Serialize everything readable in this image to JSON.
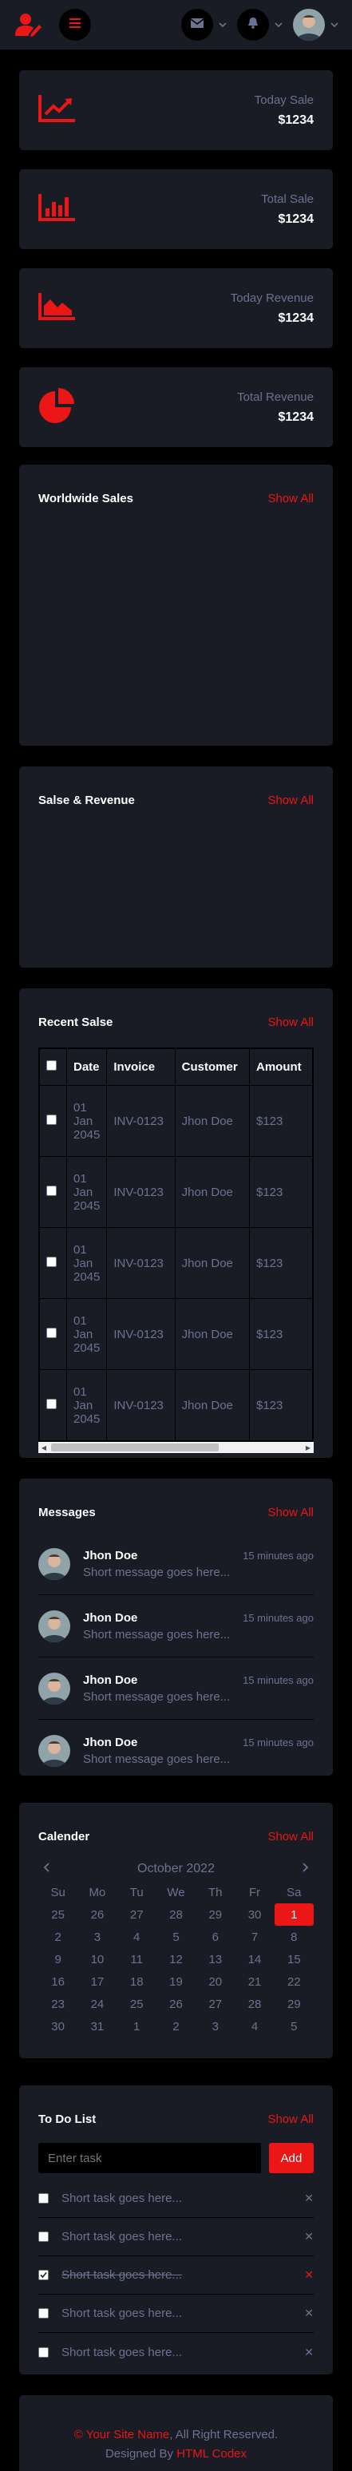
{
  "topbar": {
    "brand_icon": "user-edit-icon",
    "menu_icon": "bars-icon",
    "mail_icon": "envelope-icon",
    "bell_icon": "bell-icon"
  },
  "colors": {
    "primary": "#EB1616",
    "secondary": "#191C24",
    "light": "#6C7293",
    "dark": "#000000"
  },
  "stats": [
    {
      "label": "Today Sale",
      "value": "$1234",
      "icon": "chart-line-icon"
    },
    {
      "label": "Total Sale",
      "value": "$1234",
      "icon": "chart-bar-icon"
    },
    {
      "label": "Today Revenue",
      "value": "$1234",
      "icon": "chart-area-icon"
    },
    {
      "label": "Total Revenue",
      "value": "$1234",
      "icon": "chart-pie-icon"
    }
  ],
  "worldwide": {
    "title": "Worldwide Sales",
    "show_all": "Show All"
  },
  "revenue": {
    "title": "Salse & Revenue",
    "show_all": "Show All"
  },
  "recent": {
    "title": "Recent Salse",
    "show_all": "Show All",
    "headers": [
      "Date",
      "Invoice",
      "Customer",
      "Amount"
    ],
    "rows": [
      {
        "date": "01 Jan 2045",
        "invoice": "INV-0123",
        "customer": "Jhon Doe",
        "amount": "$123"
      },
      {
        "date": "01 Jan 2045",
        "invoice": "INV-0123",
        "customer": "Jhon Doe",
        "amount": "$123"
      },
      {
        "date": "01 Jan 2045",
        "invoice": "INV-0123",
        "customer": "Jhon Doe",
        "amount": "$123"
      },
      {
        "date": "01 Jan 2045",
        "invoice": "INV-0123",
        "customer": "Jhon Doe",
        "amount": "$123"
      },
      {
        "date": "01 Jan 2045",
        "invoice": "INV-0123",
        "customer": "Jhon Doe",
        "amount": "$123"
      }
    ]
  },
  "messages": {
    "title": "Messages",
    "show_all": "Show All",
    "items": [
      {
        "name": "Jhon Doe",
        "time": "15 minutes ago",
        "text": "Short message goes here..."
      },
      {
        "name": "Jhon Doe",
        "time": "15 minutes ago",
        "text": "Short message goes here..."
      },
      {
        "name": "Jhon Doe",
        "time": "15 minutes ago",
        "text": "Short message goes here..."
      },
      {
        "name": "Jhon Doe",
        "time": "15 minutes ago",
        "text": "Short message goes here..."
      }
    ]
  },
  "calendar": {
    "title": "Calender",
    "show_all": "Show All",
    "month": "October 2022",
    "weekdays": [
      "Su",
      "Mo",
      "Tu",
      "We",
      "Th",
      "Fr",
      "Sa"
    ],
    "days": [
      "25",
      "26",
      "27",
      "28",
      "29",
      "30",
      "1",
      "2",
      "3",
      "4",
      "5",
      "6",
      "7",
      "8",
      "9",
      "10",
      "11",
      "12",
      "13",
      "14",
      "15",
      "16",
      "17",
      "18",
      "19",
      "20",
      "21",
      "22",
      "23",
      "24",
      "25",
      "26",
      "27",
      "28",
      "29",
      "30",
      "31",
      "1",
      "2",
      "3",
      "4",
      "5"
    ],
    "selected": "1"
  },
  "todo": {
    "title": "To Do List",
    "show_all": "Show All",
    "placeholder": "Enter task",
    "add_label": "Add",
    "items": [
      {
        "text": "Short task goes here...",
        "done": false
      },
      {
        "text": "Short task goes here...",
        "done": false
      },
      {
        "text": "Short task goes here...",
        "done": true
      },
      {
        "text": "Short task goes here...",
        "done": false
      },
      {
        "text": "Short task goes here...",
        "done": false
      }
    ]
  },
  "footer": {
    "copy": "©",
    "site_name": "Your Site Name",
    "rights": ", All Right Reserved.",
    "designed_by": "Designed By",
    "designer": "HTML Codex"
  }
}
